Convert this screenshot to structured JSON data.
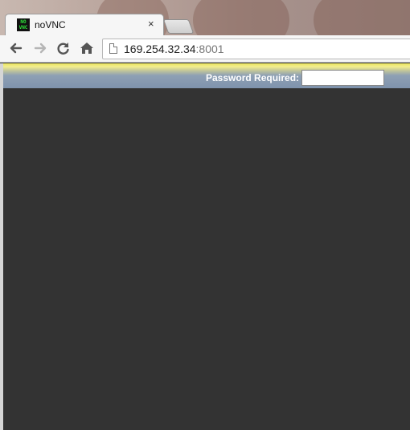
{
  "browser": {
    "tab": {
      "favicon_text": "NO VNC",
      "title": "noVNC",
      "close_glyph": "×"
    },
    "toolbar": {
      "back_icon": "arrow-left-icon",
      "forward_icon": "arrow-right-icon",
      "reload_icon": "reload-icon",
      "home_icon": "home-icon",
      "url_host": "169.254.32.34",
      "url_port": ":8001"
    }
  },
  "vnc": {
    "password_label": "Password Required:",
    "password_value": "",
    "bar_colors": {
      "top": "#e8e35c",
      "bottom": "#7f93ad"
    },
    "canvas_color": "#333333"
  }
}
